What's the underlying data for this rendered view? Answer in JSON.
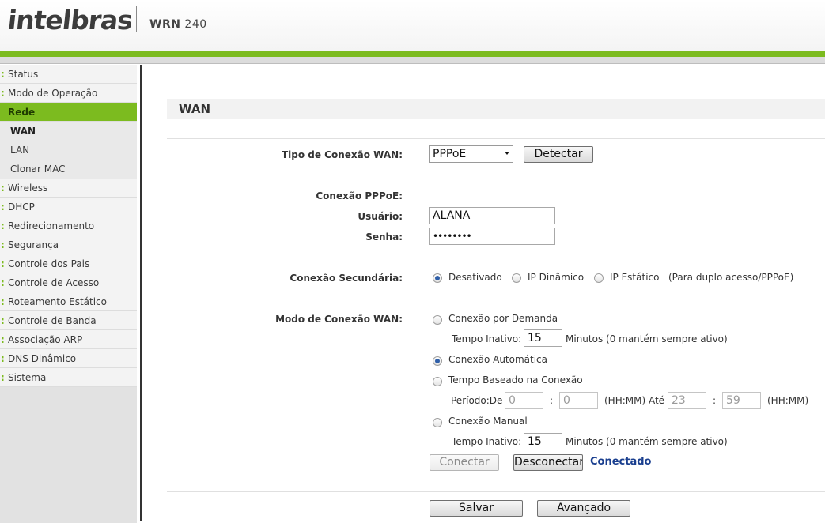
{
  "header": {
    "brand": "intelbras",
    "model_prefix": "WRN",
    "model_number": "240"
  },
  "sidebar": {
    "items": [
      {
        "label": "Status"
      },
      {
        "label": "Modo de Operação"
      },
      {
        "label": "Rede",
        "active": true
      },
      {
        "label": "WAN",
        "sub": true,
        "selected": true
      },
      {
        "label": "LAN",
        "sub": true
      },
      {
        "label": "Clonar MAC",
        "sub": true
      },
      {
        "label": "Wireless"
      },
      {
        "label": "DHCP"
      },
      {
        "label": "Redirecionamento"
      },
      {
        "label": "Segurança"
      },
      {
        "label": "Controle dos Pais"
      },
      {
        "label": "Controle de Acesso"
      },
      {
        "label": "Roteamento Estático"
      },
      {
        "label": "Controle de Banda"
      },
      {
        "label": "Associação ARP"
      },
      {
        "label": "DNS Dinâmico"
      },
      {
        "label": "Sistema"
      }
    ],
    "bullet": ":"
  },
  "page": {
    "title": "WAN",
    "wan_type_label": "Tipo de Conexão WAN:",
    "wan_type_value": "PPPoE",
    "detect_button": "Detectar",
    "pppoe_label": "Conexão PPPoE:",
    "user_label": "Usuário:",
    "user_value": "ALANA",
    "password_label": "Senha:",
    "password_value": "••••••••",
    "secondary_label": "Conexão Secundária:",
    "secondary_options": {
      "disabled": "Desativado",
      "dynamic": "IP Dinâmico",
      "static": "IP Estático",
      "note": "(Para duplo acesso/PPPoE)"
    },
    "secondary_selected": "disabled",
    "mode_label": "Modo de Conexão WAN:",
    "mode_selected": "auto",
    "on_demand": "Conexão por Demanda",
    "idle_time_label": "Tempo Inativo:",
    "idle_time_value_1": "15",
    "idle_note": "Minutos (0 mantém sempre ativo)",
    "auto": "Conexão Automática",
    "time_based": "Tempo Baseado na Conexão",
    "period_label": "Período:De",
    "period_from_h": "0",
    "period_from_m": "0",
    "hhmm_1": "(HH:MM) Até",
    "period_to_h": "23",
    "period_to_m": "59",
    "hhmm_2": "(HH:MM)",
    "colon": ":",
    "manual": "Conexão Manual",
    "idle_time_value_2": "15",
    "connect_button": "Conectar",
    "disconnect_button": "Desconectar",
    "status": "Conectado",
    "save_button": "Salvar",
    "advanced_button": "Avançado"
  }
}
